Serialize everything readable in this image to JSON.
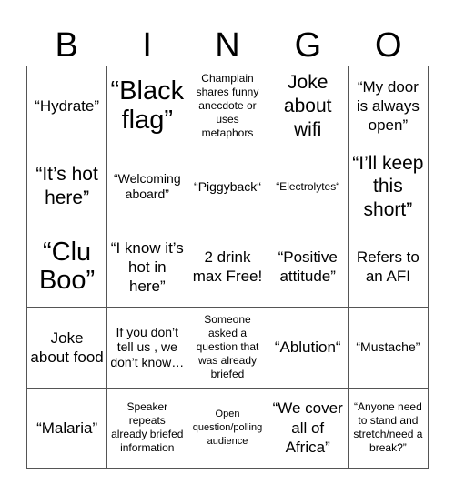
{
  "header": {
    "letters": [
      "B",
      "I",
      "N",
      "G",
      "O"
    ]
  },
  "cells": [
    [
      "“Hydrate”",
      "“Black flag”",
      "Champlain shares funny anecdote or uses metaphors",
      "Joke about wifi",
      "“My door is always open”"
    ],
    [
      "“It’s hot here”",
      "“Welcoming aboard”",
      "“Piggyback“",
      "“Electrolytes“",
      "“I’ll keep this short”"
    ],
    [
      "“Clu Boo”",
      "“I know it’s hot in here”",
      "2 drink max Free!",
      "“Positive attitude”",
      "Refers to an AFI"
    ],
    [
      "Joke about food",
      "If you don’t tell us , we don’t know…",
      "Someone asked a question that was already briefed",
      "“Ablution“",
      "“Mustache”"
    ],
    [
      "“Malaria”",
      "Speaker repeats already briefed information",
      "Open question/polling audience",
      "“We cover all of Africa”",
      "“Anyone need to stand and stretch/need a break?”"
    ]
  ]
}
